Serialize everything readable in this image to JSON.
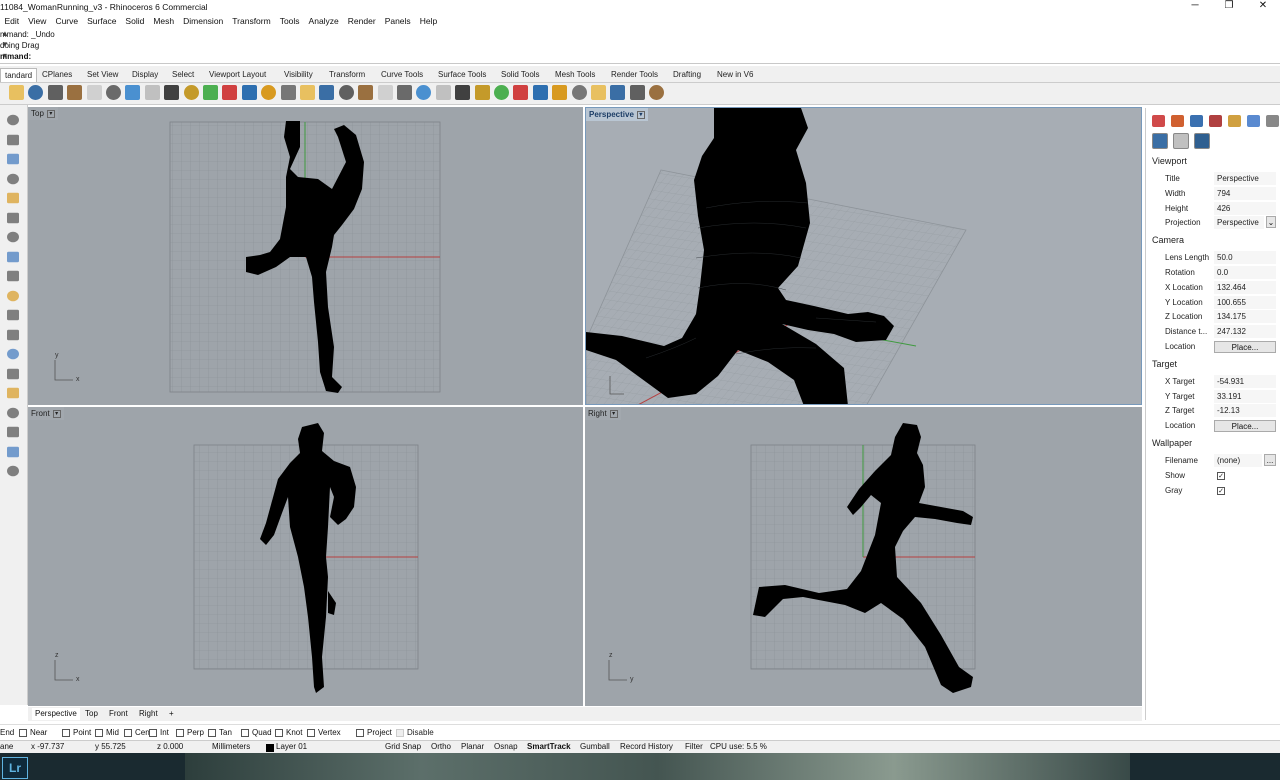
{
  "title": "11084_WomanRunning_v3 - Rhinoceros 6 Commercial",
  "window_controls": {
    "minimize": "─",
    "maximize": "❐",
    "close": "✕"
  },
  "menu": [
    "Edit",
    "View",
    "Curve",
    "Surface",
    "Solid",
    "Mesh",
    "Dimension",
    "Transform",
    "Tools",
    "Analyze",
    "Render",
    "Panels",
    "Help"
  ],
  "command_history": [
    "mmand: _Undo",
    "doing Drag"
  ],
  "command_prompt": "mmand:",
  "toolbar_tabs": [
    {
      "label": "tandard",
      "active": true
    },
    {
      "label": "CPlanes"
    },
    {
      "label": "Set View"
    },
    {
      "label": "Display"
    },
    {
      "label": "Select"
    },
    {
      "label": "Viewport Layout"
    },
    {
      "label": "Visibility"
    },
    {
      "label": "Transform"
    },
    {
      "label": "Curve Tools"
    },
    {
      "label": "Surface Tools"
    },
    {
      "label": "Solid Tools"
    },
    {
      "label": "Mesh Tools"
    },
    {
      "label": "Render Tools"
    },
    {
      "label": "Drafting"
    },
    {
      "label": "New in V6"
    }
  ],
  "toolbar_icons": [
    "new-icon",
    "open-icon",
    "save-icon",
    "print-icon",
    "import-icon",
    "cut-icon",
    "copy-icon",
    "paste-icon",
    "undo-icon",
    "pan-icon",
    "rotate-view-icon",
    "zoom-icon",
    "zoom-window-icon",
    "zoom-extents-icon",
    "zoom-selected-icon",
    "rotate-icon",
    "grid-icon",
    "move-icon",
    "car-icon",
    "select-icon",
    "curve-icon",
    "light-icon",
    "lock-icon",
    "layer-icon",
    "color-wheel-icon",
    "material-icon",
    "render-icon",
    "sphere-icon",
    "shade-icon",
    "options-icon",
    "settings-icon",
    "snap-icon",
    "mesh-icon",
    "help-icon"
  ],
  "toolbar_colors": [
    "#e8c060",
    "#3a6ea5",
    "#606060",
    "#9a7040",
    "#d0d0d0",
    "#6a6a6a",
    "#4a90d0",
    "#c0c0c0",
    "#404040",
    "#c49a2a",
    "#4caf50",
    "#d04040",
    "#2d6fb0",
    "#d89a20",
    "#777777"
  ],
  "viewports": [
    {
      "name": "Top",
      "active": false
    },
    {
      "name": "Perspective",
      "active": true
    },
    {
      "name": "Front",
      "active": false
    },
    {
      "name": "Right",
      "active": false
    }
  ],
  "axis_labels": {
    "top": [
      "y",
      "x"
    ],
    "front": [
      "z",
      "x"
    ],
    "right": [
      "z",
      "y"
    ]
  },
  "viewport_tabs": [
    "Perspective",
    "Top",
    "Front",
    "Right",
    "+"
  ],
  "panel_tab_icons": [
    "color-icon",
    "layers-icon",
    "material-icon",
    "brush-icon",
    "folder-icon",
    "image-icon",
    "more-icon"
  ],
  "properties": {
    "sections": [
      {
        "title": "Viewport",
        "rows": [
          {
            "label": "Title",
            "value": "Perspective"
          },
          {
            "label": "Width",
            "value": "794"
          },
          {
            "label": "Height",
            "value": "426"
          },
          {
            "label": "Projection",
            "value": "Perspective",
            "dropdown": true
          }
        ]
      },
      {
        "title": "Camera",
        "rows": [
          {
            "label": "Lens Length",
            "value": "50.0"
          },
          {
            "label": "Rotation",
            "value": "0.0"
          },
          {
            "label": "X Location",
            "value": "132.464"
          },
          {
            "label": "Y Location",
            "value": "100.655"
          },
          {
            "label": "Z Location",
            "value": "134.175"
          },
          {
            "label": "Distance t...",
            "value": "247.132"
          },
          {
            "label": "Location",
            "button": "Place..."
          }
        ]
      },
      {
        "title": "Target",
        "rows": [
          {
            "label": "X Target",
            "value": "-54.931"
          },
          {
            "label": "Y Target",
            "value": "33.191"
          },
          {
            "label": "Z Target",
            "value": "-12.13"
          },
          {
            "label": "Location",
            "button": "Place..."
          }
        ]
      },
      {
        "title": "Wallpaper",
        "rows": [
          {
            "label": "Filename",
            "value": "(none)",
            "button": "..."
          },
          {
            "label": "Show",
            "check": true
          },
          {
            "label": "Gray",
            "check": true
          }
        ]
      }
    ]
  },
  "osnaps": [
    {
      "label": "End",
      "checked": false
    },
    {
      "label": "Near",
      "checked": false
    },
    {
      "label": "Point",
      "checked": false
    },
    {
      "label": "Mid",
      "checked": false
    },
    {
      "label": "Cen",
      "checked": false
    },
    {
      "label": "Int",
      "checked": false
    },
    {
      "label": "Perp",
      "checked": false
    },
    {
      "label": "Tan",
      "checked": false
    },
    {
      "label": "Quad",
      "checked": false
    },
    {
      "label": "Knot",
      "checked": false
    },
    {
      "label": "Vertex",
      "checked": false
    },
    {
      "label": "Project",
      "checked": false
    },
    {
      "label": "Disable",
      "checked": false
    }
  ],
  "status": {
    "plane": "ane",
    "x": "x -97.737",
    "y": "y 55.725",
    "z": "z 0.000",
    "units": "Millimeters",
    "layer": "Layer 01",
    "toggles": [
      "Grid Snap",
      "Ortho",
      "Planar",
      "Osnap",
      "SmartTrack",
      "Gumball",
      "Record History",
      "Filter"
    ],
    "active_toggle": "SmartTrack",
    "cpu": "CPU use: 5.5 %"
  }
}
